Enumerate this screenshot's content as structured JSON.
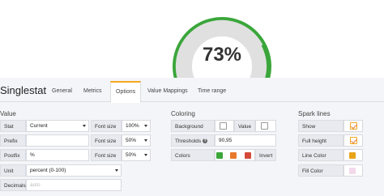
{
  "gauge": {
    "value_text": "73%",
    "percent": 73,
    "colors": {
      "green": "#3aa63a",
      "orange": "#e8792b",
      "red": "#d44a3a",
      "track": "#e0e0e0"
    }
  },
  "panel_title": "Singlestat",
  "tabs": [
    "General",
    "Metrics",
    "Options",
    "Value Mappings",
    "Time range"
  ],
  "active_tab": "Options",
  "value_section": {
    "title": "Value",
    "stat_label": "Stat",
    "stat_value": "Current",
    "prefix_label": "Prefix",
    "prefix_value": "",
    "postfix_label": "Postfix",
    "postfix_value": "%",
    "unit_label": "Unit",
    "unit_value": "percent (0-100)",
    "decimals_label": "Decimals",
    "decimals_placeholder": "auto",
    "font_size_label": "Font size",
    "font_size_1": "100%",
    "font_size_2": "50%",
    "font_size_3": "50%"
  },
  "coloring": {
    "title": "Coloring",
    "background_label": "Background",
    "value_label": "Value",
    "thresholds_label": "Thresholds",
    "thresholds_value": "90,95",
    "colors_label": "Colors",
    "invert_label": "Invert",
    "swatches": [
      "#3aa63a",
      "#e8792b",
      "#d44a3a"
    ]
  },
  "spark_lines": {
    "title": "Spark lines",
    "show_label": "Show",
    "full_height_label": "Full height",
    "line_color_label": "Line Color",
    "fill_color_label": "Fill Color",
    "line_color": "#e8a317",
    "fill_color": "#f3d9ec"
  }
}
